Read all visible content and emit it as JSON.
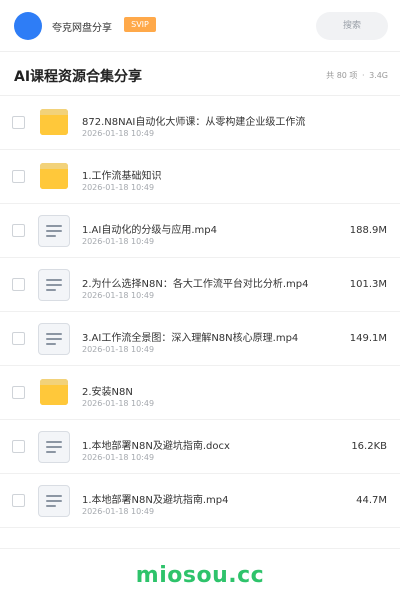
{
  "header": {
    "username": "夸克网盘分享",
    "badge": "SVIP",
    "search_placeholder": "搜索",
    "accent_color": "#2e7df6",
    "badge_color": "#ffa94a",
    "avatar_icon": "avatar-circle"
  },
  "title_row": {
    "title": "AI课程资源合集分享",
    "count": "共 80 项",
    "separator": "·",
    "total_size": "3.4G"
  },
  "files": [
    {
      "type": "folder",
      "icon": "folder-icon",
      "name": "872.N8NAI自动化大师课：从零构建企业级工作流",
      "date": "2026-01-18 10:49",
      "size": ""
    },
    {
      "type": "folder",
      "icon": "folder-icon",
      "name": "1.工作流基础知识",
      "date": "2026-01-18 10:49",
      "size": ""
    },
    {
      "type": "file",
      "icon": "document-icon",
      "name": "1.AI自动化的分级与应用.mp4",
      "date": "2026-01-18 10:49",
      "size": "188.9M"
    },
    {
      "type": "file",
      "icon": "document-icon",
      "name": "2.为什么选择N8N：各大工作流平台对比分析.mp4",
      "date": "2026-01-18 10:49",
      "size": "101.3M"
    },
    {
      "type": "file",
      "icon": "document-icon",
      "name": "3.AI工作流全景图：深入理解N8N核心原理.mp4",
      "date": "2026-01-18 10:49",
      "size": "149.1M"
    },
    {
      "type": "folder",
      "icon": "folder-icon",
      "name": "2.安装N8N",
      "date": "2026-01-18 10:49",
      "size": ""
    },
    {
      "type": "file",
      "icon": "document-icon",
      "name": "1.本地部署N8N及避坑指南.docx",
      "date": "2026-01-18 10:49",
      "size": "16.2KB"
    },
    {
      "type": "file",
      "icon": "document-icon",
      "name": "1.本地部署N8N及避坑指南.mp4",
      "date": "2026-01-18 10:49",
      "size": "44.7M"
    }
  ],
  "footer": {
    "watermark": "miosou.cc",
    "watermark_color": "#2ec36b"
  }
}
